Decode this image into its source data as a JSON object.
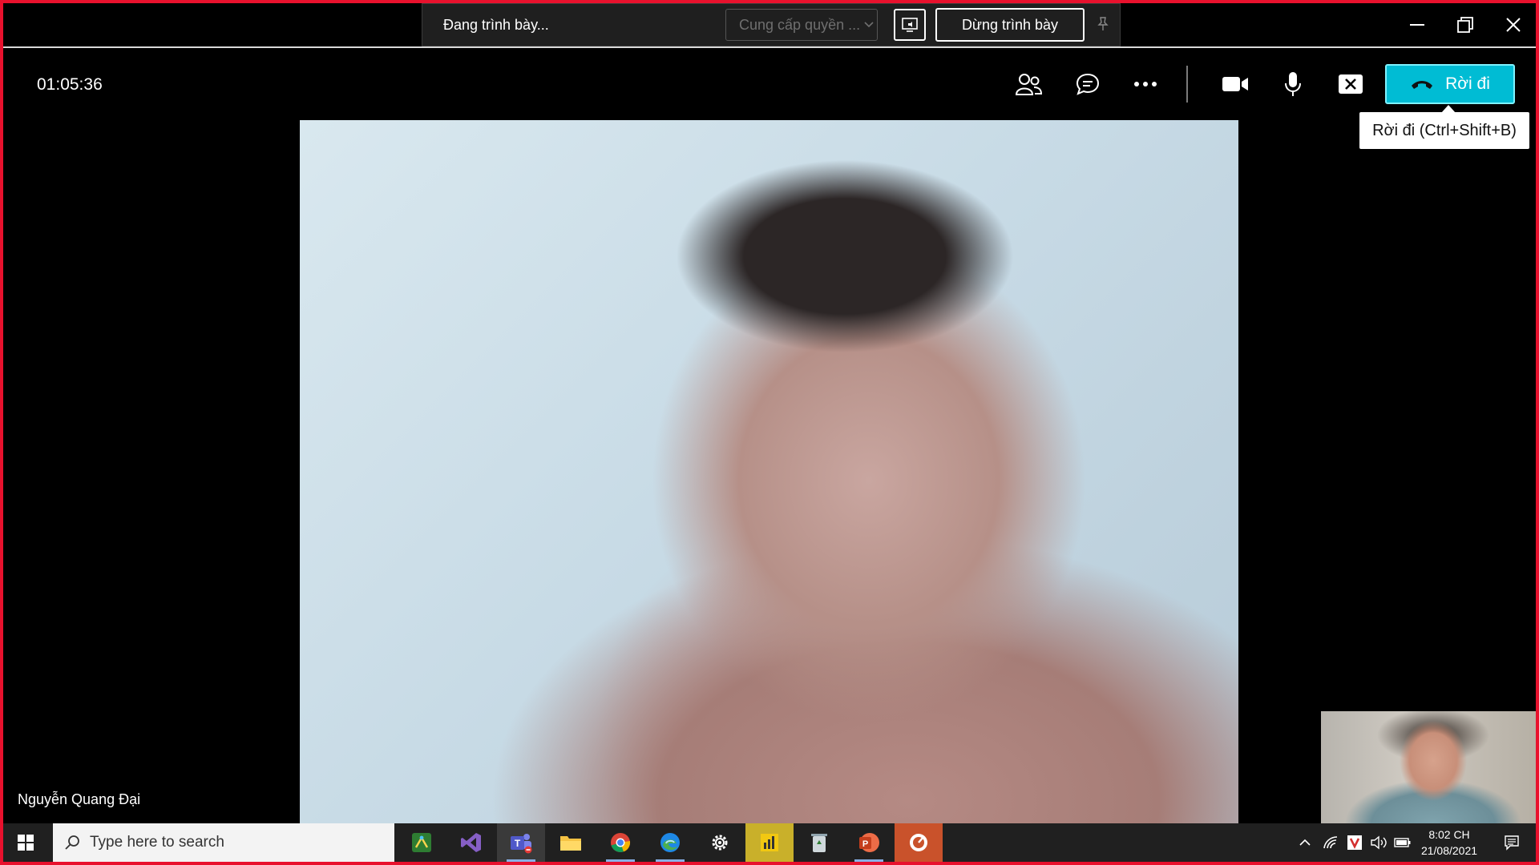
{
  "share_bar": {
    "status": "Đang trình bày...",
    "control_dropdown": "Cung cấp quyền ...",
    "stop_button": "Dừng trình bày"
  },
  "meeting": {
    "duration": "01:05:36",
    "leave_label": "Rời đi",
    "leave_tooltip": "Rời đi (Ctrl+Shift+B)",
    "participant_name": "Nguyễn Quang Đại",
    "accent_color": "#00bcd4",
    "border_color": "#e8112d",
    "icons": [
      "participants-icon",
      "chat-icon",
      "more-options-icon",
      "camera-icon",
      "microphone-icon",
      "stop-sharing-icon",
      "phone-hangup-icon"
    ]
  },
  "taskbar": {
    "search_placeholder": "Type here to search",
    "apps": [
      "network-tool-icon",
      "visual-studio-icon",
      "teams-icon",
      "file-explorer-icon",
      "chrome-icon",
      "edge-icon",
      "settings-icon",
      "power-bi-icon",
      "recycle-bin-icon",
      "powerpoint-icon",
      "screen-recorder-icon"
    ],
    "clock_time": "8:02 CH",
    "clock_date": "21/08/2021"
  }
}
